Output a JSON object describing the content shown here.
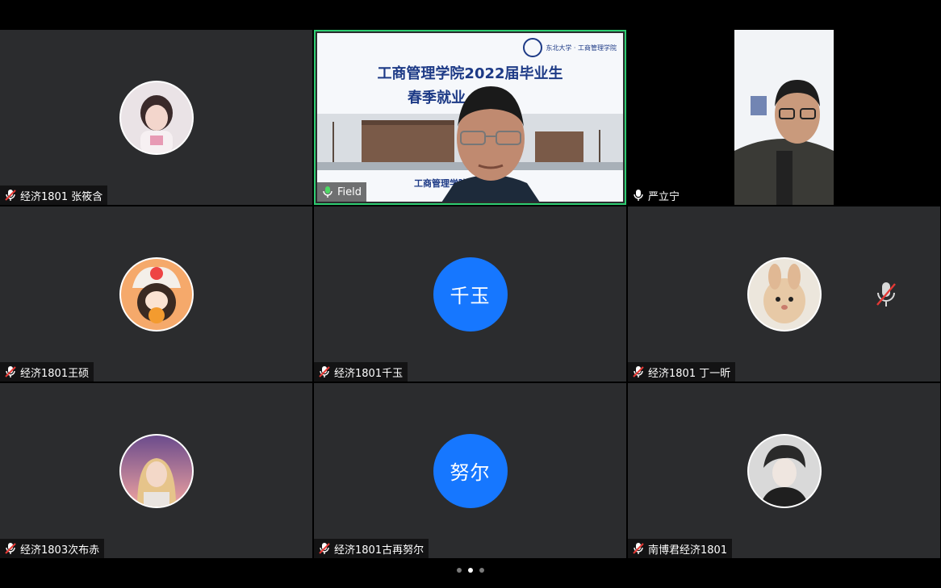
{
  "participants": [
    {
      "name": "经济1801 张筱含",
      "mic": "muted-mic-icon"
    },
    {
      "name": "Field",
      "mic": "mic-icon",
      "is_presenter": true
    },
    {
      "name": "严立宁",
      "mic": "mic-icon"
    },
    {
      "name": "经济1801王硕",
      "mic": "muted-mic-icon"
    },
    {
      "name": "经济1801千玉",
      "mic": "muted-mic-icon",
      "initials": "千玉"
    },
    {
      "name": "经济1801 丁一昕",
      "mic": "muted-mic-icon"
    },
    {
      "name": "经济1803次布赤",
      "mic": "muted-mic-icon"
    },
    {
      "name": "经济1801古再努尔",
      "mic": "muted-mic-icon",
      "initials": "努尔"
    },
    {
      "name": "南博君经济1801",
      "mic": "muted-mic-icon"
    }
  ],
  "slide": {
    "title": "工商管理学院2022届毕业生",
    "subtitle": "春季就业",
    "footer": "工商管理学院",
    "logo_text": "东北大学 · 工商管理学院"
  },
  "pager": {
    "pages": 3,
    "active_index": 1
  },
  "colors": {
    "tile_bg": "#2b2c2e",
    "initial_circle": "#1677ff",
    "active_speaker_border": "#2ecc71",
    "muted_red": "#e53935"
  }
}
